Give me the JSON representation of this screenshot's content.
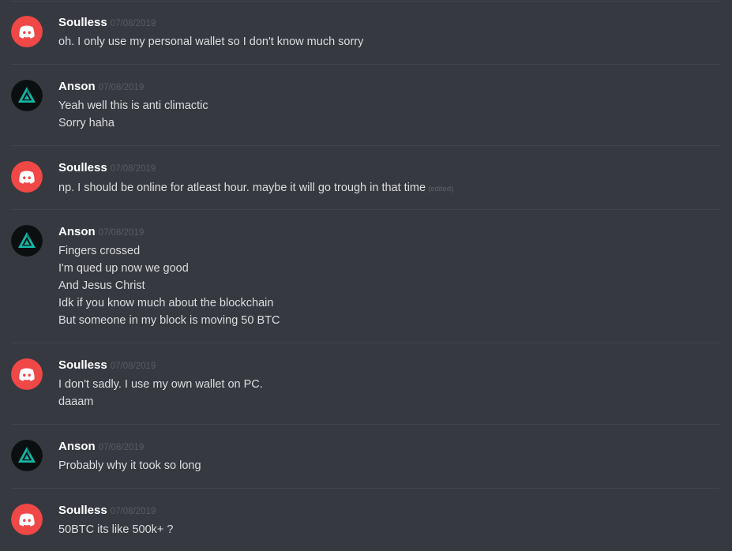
{
  "colors": {
    "background": "#36393f",
    "divider": "#42454b",
    "username": "#ffffff",
    "timestamp": "#585c62",
    "message_text": "#dcddde",
    "soulless_avatar_bg": "#f04747",
    "anson_avatar_bg": "#0c0f10",
    "anson_logo_teal": "#13b7a5"
  },
  "messages": [
    {
      "author": "Soulless",
      "avatar_icon": "discord-logo-icon",
      "timestamp": "07/08/2019",
      "lines": [
        "oh.  I only use my personal wallet  so I don't know much sorry"
      ]
    },
    {
      "author": "Anson",
      "avatar_icon": "teal-triangle-logo-icon",
      "timestamp": "07/08/2019",
      "lines": [
        "Yeah well this is anti climactic",
        "Sorry haha"
      ]
    },
    {
      "author": "Soulless",
      "avatar_icon": "discord-logo-icon",
      "timestamp": "07/08/2019",
      "lines": [
        "np.  I should be online for  atleast hour.   maybe it will go trough in that time"
      ],
      "edited_label": "(edited)"
    },
    {
      "author": "Anson",
      "avatar_icon": "teal-triangle-logo-icon",
      "timestamp": "07/08/2019",
      "lines": [
        "Fingers crossed",
        "I'm qued up now we good",
        "And Jesus Christ",
        "Idk if you know much about the blockchain",
        "But someone in my block is moving 50 BTC"
      ]
    },
    {
      "author": "Soulless",
      "avatar_icon": "discord-logo-icon",
      "timestamp": "07/08/2019",
      "lines": [
        "I don't sadly.  I use my own wallet on PC.",
        "daaam"
      ]
    },
    {
      "author": "Anson",
      "avatar_icon": "teal-triangle-logo-icon",
      "timestamp": "07/08/2019",
      "lines": [
        "Probably why it took so long"
      ]
    },
    {
      "author": "Soulless",
      "avatar_icon": "discord-logo-icon",
      "timestamp": "07/08/2019",
      "lines": [
        "50BTC its like  500k+ ?"
      ]
    }
  ]
}
